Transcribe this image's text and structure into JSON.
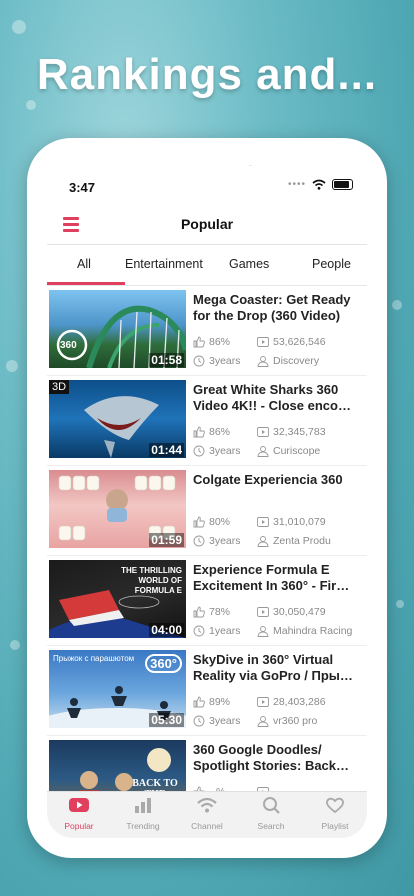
{
  "promo": {
    "headline": "Rankings and..."
  },
  "status": {
    "time": "3:47"
  },
  "header": {
    "title": "Popular"
  },
  "tabs": [
    {
      "label": "All",
      "active": true
    },
    {
      "label": "Entertainment"
    },
    {
      "label": "Games"
    },
    {
      "label": "People"
    }
  ],
  "videos": [
    {
      "title": "Mega Coaster: Get Ready for the Drop (360 Video)",
      "duration": "01:58",
      "likes": "86%",
      "views": "53,626,546",
      "age": "3years",
      "channel": "Discovery"
    },
    {
      "title": "Great White Sharks 360 Video 4K!! - Close enco…",
      "duration": "01:44",
      "likes": "86%",
      "views": "32,345,783",
      "age": "3years",
      "channel": "Curiscope"
    },
    {
      "title": "Colgate Experiencia 360",
      "duration": "01:59",
      "likes": "80%",
      "views": "31,010,079",
      "age": "3years",
      "channel": "Zenta Produ"
    },
    {
      "title": "Experience Formula E Excitement In 360° - Fir…",
      "duration": "04:00",
      "likes": "78%",
      "views": "30,050,479",
      "age": "1years",
      "channel": "Mahindra Racing"
    },
    {
      "title": "SkyDive in 360° Virtual Reality via GoPro / Пры…",
      "duration": "05:30",
      "likes": "89%",
      "views": "28,403,286",
      "age": "3years",
      "channel": "vr360 pro"
    },
    {
      "title": "360 Google Doodles/ Spotlight Stories: Back…",
      "duration": "",
      "likes": "--%",
      "views": "",
      "age": "",
      "channel": ""
    }
  ],
  "thumbnail_overlays": {
    "badge_360": "360",
    "badge_3d": "3D",
    "formula_text": "THE THRILLING WORLD OF FORMULA E",
    "skydive_text": "Прыжок с парашютом",
    "skydive_badge": "360°",
    "doodle_text": "BACK TO THE MOON"
  },
  "tabbar": [
    {
      "label": "Popular",
      "icon": "youtube-play-icon",
      "active": true
    },
    {
      "label": "Trending",
      "icon": "bar-chart-icon"
    },
    {
      "label": "Channel",
      "icon": "wifi-broadcast-icon"
    },
    {
      "label": "Search",
      "icon": "search-icon"
    },
    {
      "label": "Playlist",
      "icon": "heart-icon"
    }
  ],
  "colors": {
    "accent": "#e0405e",
    "background": "#5fb3be"
  }
}
